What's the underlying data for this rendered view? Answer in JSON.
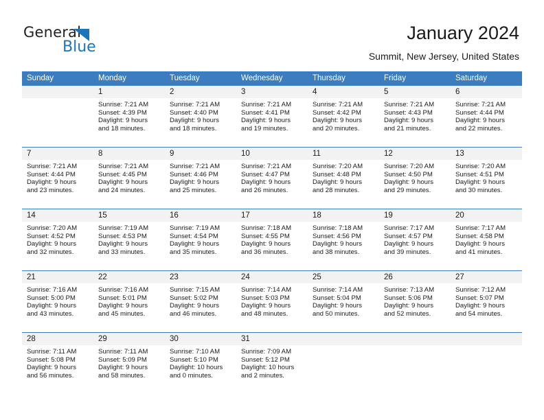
{
  "brand": {
    "name_dark": "General",
    "name_blue": "Blue",
    "accent_color": "#1b75bb"
  },
  "header": {
    "title": "January 2024",
    "subtitle": "Summit, New Jersey, United States"
  },
  "calendar": {
    "header_color": "#3b7dbf",
    "weekdays": [
      "Sunday",
      "Monday",
      "Tuesday",
      "Wednesday",
      "Thursday",
      "Friday",
      "Saturday"
    ],
    "weeks": [
      [
        {
          "day": "",
          "empty": true
        },
        {
          "day": "1",
          "sunrise": "Sunrise: 7:21 AM",
          "sunset": "Sunset: 4:39 PM",
          "daylight_1": "Daylight: 9 hours",
          "daylight_2": "and 18 minutes."
        },
        {
          "day": "2",
          "sunrise": "Sunrise: 7:21 AM",
          "sunset": "Sunset: 4:40 PM",
          "daylight_1": "Daylight: 9 hours",
          "daylight_2": "and 18 minutes."
        },
        {
          "day": "3",
          "sunrise": "Sunrise: 7:21 AM",
          "sunset": "Sunset: 4:41 PM",
          "daylight_1": "Daylight: 9 hours",
          "daylight_2": "and 19 minutes."
        },
        {
          "day": "4",
          "sunrise": "Sunrise: 7:21 AM",
          "sunset": "Sunset: 4:42 PM",
          "daylight_1": "Daylight: 9 hours",
          "daylight_2": "and 20 minutes."
        },
        {
          "day": "5",
          "sunrise": "Sunrise: 7:21 AM",
          "sunset": "Sunset: 4:43 PM",
          "daylight_1": "Daylight: 9 hours",
          "daylight_2": "and 21 minutes."
        },
        {
          "day": "6",
          "sunrise": "Sunrise: 7:21 AM",
          "sunset": "Sunset: 4:44 PM",
          "daylight_1": "Daylight: 9 hours",
          "daylight_2": "and 22 minutes."
        }
      ],
      [
        {
          "day": "7",
          "sunrise": "Sunrise: 7:21 AM",
          "sunset": "Sunset: 4:44 PM",
          "daylight_1": "Daylight: 9 hours",
          "daylight_2": "and 23 minutes."
        },
        {
          "day": "8",
          "sunrise": "Sunrise: 7:21 AM",
          "sunset": "Sunset: 4:45 PM",
          "daylight_1": "Daylight: 9 hours",
          "daylight_2": "and 24 minutes."
        },
        {
          "day": "9",
          "sunrise": "Sunrise: 7:21 AM",
          "sunset": "Sunset: 4:46 PM",
          "daylight_1": "Daylight: 9 hours",
          "daylight_2": "and 25 minutes."
        },
        {
          "day": "10",
          "sunrise": "Sunrise: 7:21 AM",
          "sunset": "Sunset: 4:47 PM",
          "daylight_1": "Daylight: 9 hours",
          "daylight_2": "and 26 minutes."
        },
        {
          "day": "11",
          "sunrise": "Sunrise: 7:20 AM",
          "sunset": "Sunset: 4:48 PM",
          "daylight_1": "Daylight: 9 hours",
          "daylight_2": "and 28 minutes."
        },
        {
          "day": "12",
          "sunrise": "Sunrise: 7:20 AM",
          "sunset": "Sunset: 4:50 PM",
          "daylight_1": "Daylight: 9 hours",
          "daylight_2": "and 29 minutes."
        },
        {
          "day": "13",
          "sunrise": "Sunrise: 7:20 AM",
          "sunset": "Sunset: 4:51 PM",
          "daylight_1": "Daylight: 9 hours",
          "daylight_2": "and 30 minutes."
        }
      ],
      [
        {
          "day": "14",
          "sunrise": "Sunrise: 7:20 AM",
          "sunset": "Sunset: 4:52 PM",
          "daylight_1": "Daylight: 9 hours",
          "daylight_2": "and 32 minutes."
        },
        {
          "day": "15",
          "sunrise": "Sunrise: 7:19 AM",
          "sunset": "Sunset: 4:53 PM",
          "daylight_1": "Daylight: 9 hours",
          "daylight_2": "and 33 minutes."
        },
        {
          "day": "16",
          "sunrise": "Sunrise: 7:19 AM",
          "sunset": "Sunset: 4:54 PM",
          "daylight_1": "Daylight: 9 hours",
          "daylight_2": "and 35 minutes."
        },
        {
          "day": "17",
          "sunrise": "Sunrise: 7:18 AM",
          "sunset": "Sunset: 4:55 PM",
          "daylight_1": "Daylight: 9 hours",
          "daylight_2": "and 36 minutes."
        },
        {
          "day": "18",
          "sunrise": "Sunrise: 7:18 AM",
          "sunset": "Sunset: 4:56 PM",
          "daylight_1": "Daylight: 9 hours",
          "daylight_2": "and 38 minutes."
        },
        {
          "day": "19",
          "sunrise": "Sunrise: 7:17 AM",
          "sunset": "Sunset: 4:57 PM",
          "daylight_1": "Daylight: 9 hours",
          "daylight_2": "and 39 minutes."
        },
        {
          "day": "20",
          "sunrise": "Sunrise: 7:17 AM",
          "sunset": "Sunset: 4:58 PM",
          "daylight_1": "Daylight: 9 hours",
          "daylight_2": "and 41 minutes."
        }
      ],
      [
        {
          "day": "21",
          "sunrise": "Sunrise: 7:16 AM",
          "sunset": "Sunset: 5:00 PM",
          "daylight_1": "Daylight: 9 hours",
          "daylight_2": "and 43 minutes."
        },
        {
          "day": "22",
          "sunrise": "Sunrise: 7:16 AM",
          "sunset": "Sunset: 5:01 PM",
          "daylight_1": "Daylight: 9 hours",
          "daylight_2": "and 45 minutes."
        },
        {
          "day": "23",
          "sunrise": "Sunrise: 7:15 AM",
          "sunset": "Sunset: 5:02 PM",
          "daylight_1": "Daylight: 9 hours",
          "daylight_2": "and 46 minutes."
        },
        {
          "day": "24",
          "sunrise": "Sunrise: 7:14 AM",
          "sunset": "Sunset: 5:03 PM",
          "daylight_1": "Daylight: 9 hours",
          "daylight_2": "and 48 minutes."
        },
        {
          "day": "25",
          "sunrise": "Sunrise: 7:14 AM",
          "sunset": "Sunset: 5:04 PM",
          "daylight_1": "Daylight: 9 hours",
          "daylight_2": "and 50 minutes."
        },
        {
          "day": "26",
          "sunrise": "Sunrise: 7:13 AM",
          "sunset": "Sunset: 5:06 PM",
          "daylight_1": "Daylight: 9 hours",
          "daylight_2": "and 52 minutes."
        },
        {
          "day": "27",
          "sunrise": "Sunrise: 7:12 AM",
          "sunset": "Sunset: 5:07 PM",
          "daylight_1": "Daylight: 9 hours",
          "daylight_2": "and 54 minutes."
        }
      ],
      [
        {
          "day": "28",
          "sunrise": "Sunrise: 7:11 AM",
          "sunset": "Sunset: 5:08 PM",
          "daylight_1": "Daylight: 9 hours",
          "daylight_2": "and 56 minutes."
        },
        {
          "day": "29",
          "sunrise": "Sunrise: 7:11 AM",
          "sunset": "Sunset: 5:09 PM",
          "daylight_1": "Daylight: 9 hours",
          "daylight_2": "and 58 minutes."
        },
        {
          "day": "30",
          "sunrise": "Sunrise: 7:10 AM",
          "sunset": "Sunset: 5:10 PM",
          "daylight_1": "Daylight: 10 hours",
          "daylight_2": "and 0 minutes."
        },
        {
          "day": "31",
          "sunrise": "Sunrise: 7:09 AM",
          "sunset": "Sunset: 5:12 PM",
          "daylight_1": "Daylight: 10 hours",
          "daylight_2": "and 2 minutes."
        },
        {
          "day": "",
          "empty": true
        },
        {
          "day": "",
          "empty": true
        },
        {
          "day": "",
          "empty": true
        }
      ]
    ]
  }
}
